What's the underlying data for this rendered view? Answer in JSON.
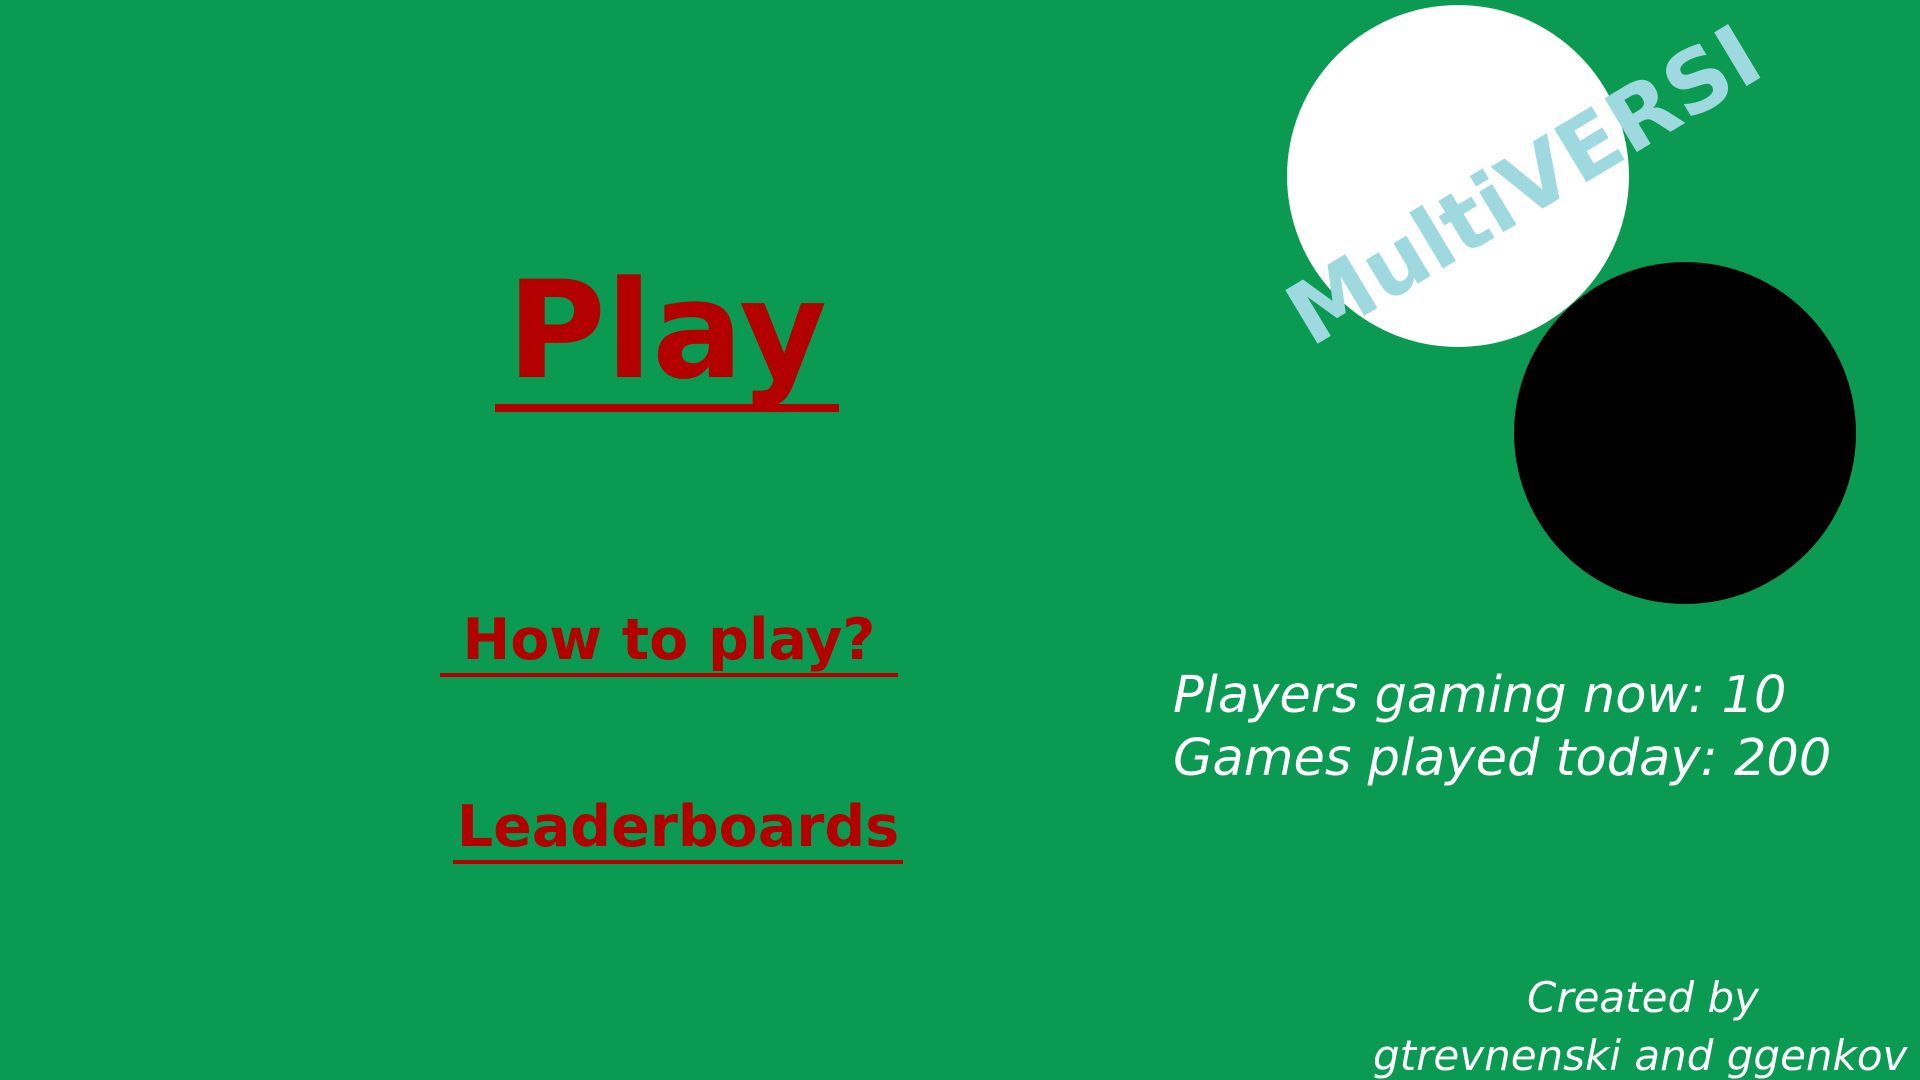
{
  "colors": {
    "background": "#0a9a52",
    "menu_text": "#b30000",
    "logo_text": "#9fd9e0",
    "stat_text": "#ffffff",
    "white_disc": "#ffffff",
    "black_disc": "#000000"
  },
  "menu": {
    "play_label": "Play",
    "how_to_play_label": "How to play?",
    "leaderboards_label": "Leaderboards"
  },
  "logo": {
    "text": "MultiVERSI"
  },
  "stats": {
    "players_label": "Players gaming now:",
    "players_value": "10",
    "games_label": "Games played today:",
    "games_value": "200"
  },
  "credits": {
    "line1": "Created by",
    "line2": "gtrevnenski and ggenkov"
  }
}
